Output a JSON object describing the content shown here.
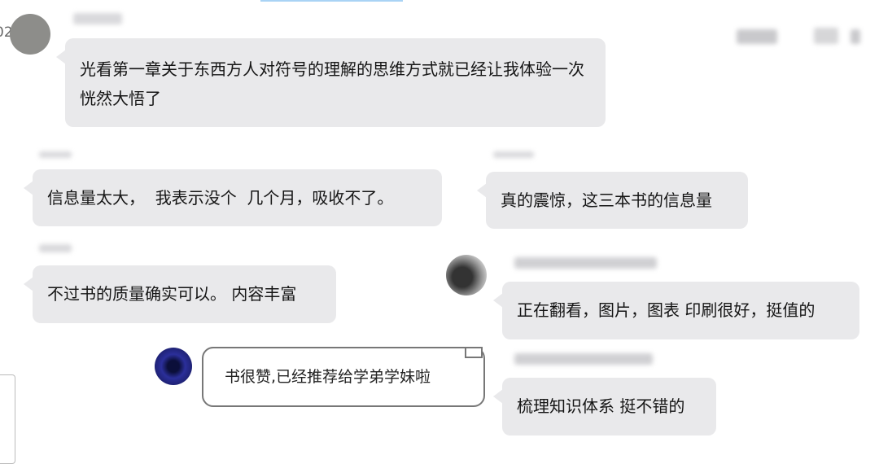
{
  "top_left_fragment": "02",
  "messages": [
    {
      "text": "光看第一章关于东西方人对符号的理解的思维方式就已经让我体验一次恍然大悟了"
    },
    {
      "text": "信息量太大，  我表示没个  几个月，吸收不了。"
    },
    {
      "text": "真的震惊，这三本书的信息量"
    },
    {
      "text": "不过书的质量确实可以。 内容丰富"
    },
    {
      "text": "正在翻看，图片，图表 印刷很好，挺值的"
    },
    {
      "text": "书很赞,已经推荐给学弟学妹啦"
    },
    {
      "text": "梳理知识体系 挺不错的"
    }
  ],
  "colors": {
    "bubble": "#e9e9eb",
    "outlined_bubble_border": "#777777",
    "background": "#ffffff"
  },
  "icons": {
    "avatar_1": "gray-circle-avatar",
    "avatar_5": "photo-avatar",
    "avatar_6": "blue-avatar"
  }
}
